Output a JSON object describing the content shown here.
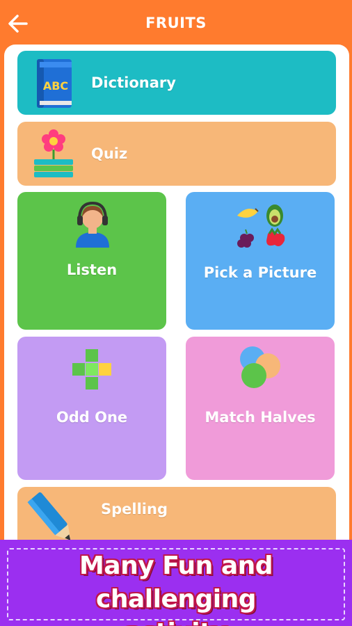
{
  "header": {
    "title": "FRUITS",
    "back_icon": "arrow-left-icon"
  },
  "activities": [
    {
      "label": "Dictionary",
      "color": "#1dbcc4",
      "icon": "abc-book-icon"
    },
    {
      "label": "Quiz",
      "color": "#f7b778",
      "icon": "flower-books-icon"
    },
    {
      "label": "Listen",
      "color": "#5cc44a",
      "icon": "headphones-person-icon"
    },
    {
      "label": "Pick a Picture",
      "color": "#5aaef3",
      "icon": "fruits-grid-icon"
    },
    {
      "label": "Odd One",
      "color": "#c39bf3",
      "icon": "cross-blocks-icon"
    },
    {
      "label": "Match Halves",
      "color": "#f09bd9",
      "icon": "overlapping-circles-icon"
    },
    {
      "label": "Spelling",
      "color": "#f7b778",
      "icon": "pencil-icon"
    }
  ],
  "banner": {
    "line1": "Many Fun and challenging",
    "line2": "activity",
    "background": "#9b2ff0"
  },
  "colors": {
    "header": "#ff7b2e",
    "panel": "#ffffff"
  }
}
